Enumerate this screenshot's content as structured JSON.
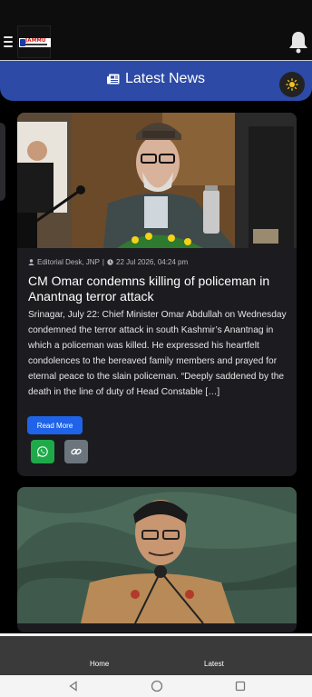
{
  "header": {
    "logo_text": "JAMMU",
    "menu_icon": "hamburger-icon",
    "notification_icon": "bell-icon"
  },
  "banner": {
    "title": "Latest News",
    "icon": "newspaper-icon",
    "toggle_icon": "sun-icon"
  },
  "articles": [
    {
      "author": "Editorial Desk, JNP",
      "separator": "|",
      "date": "22 Jul 2026, 04:24 pm",
      "title": "CM Omar condemns killing of policeman in Anantnag terror attack",
      "excerpt": "Srinagar, July 22: Chief Minister Omar Abdullah on Wednesday condemned the terror attack in south Kashmir’s Anantnag in which a policeman was killed. He expressed his heartfelt condolences to the bereaved family members and prayed for eternal peace to the slain policeman. “Deeply saddened by the death in the line of duty of Head Constable […]",
      "read_more": "Read More"
    }
  ],
  "colors": {
    "banner": "#2c4aa6",
    "read_more": "#1f63e8",
    "whatsapp": "#1faa4a",
    "link": "#6c757d"
  },
  "bottom_nav": {
    "items": [
      {
        "label": "Home"
      },
      {
        "label": "Latest"
      }
    ]
  }
}
